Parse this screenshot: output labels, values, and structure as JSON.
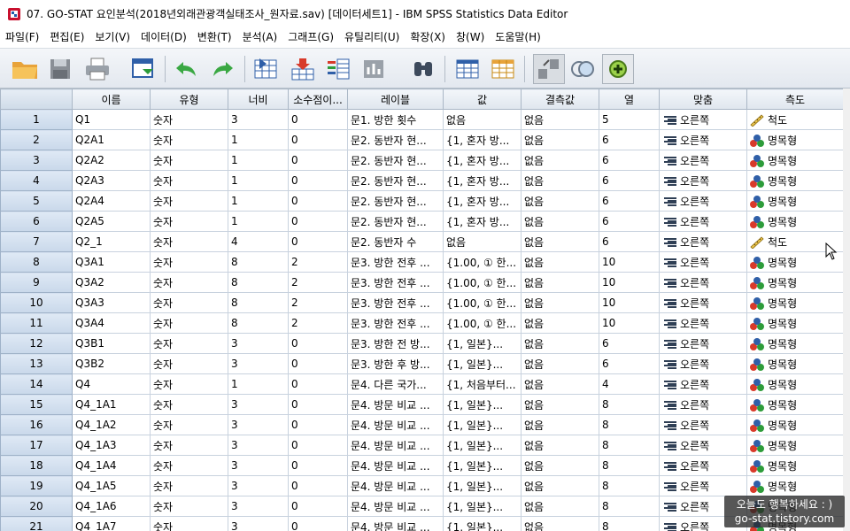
{
  "window": {
    "title": "07. GO-STAT 요인분석(2018년외래관광객실태조사_원자료.sav) [데이터세트1] - IBM SPSS Statistics Data Editor"
  },
  "menu": [
    "파일(F)",
    "편집(E)",
    "보기(V)",
    "데이터(D)",
    "변환(T)",
    "분석(A)",
    "그래프(G)",
    "유틸리티(U)",
    "확장(X)",
    "창(W)",
    "도움말(H)"
  ],
  "toolbar": {
    "icons": [
      "open-folder-icon",
      "save-icon",
      "print-icon",
      "recall-dialog-icon",
      "undo-icon",
      "redo-icon",
      "goto-case-icon",
      "goto-variable-icon",
      "variables-icon",
      "find-icon",
      "insert-cases-icon",
      "insert-variable-icon",
      "split-file-icon",
      "weight-cases-icon",
      "select-cases-icon",
      "value-labels-icon",
      "use-sets-icon"
    ]
  },
  "columns": [
    "이름",
    "유형",
    "너비",
    "소수점이...",
    "레이블",
    "값",
    "결측값",
    "열",
    "맞춤",
    "측도"
  ],
  "colors": {
    "header_bg": "#e4ebf3",
    "rownum_bg": "#d3e0ef",
    "accent": "#2f5fa8"
  },
  "rows": [
    {
      "n": "1",
      "name": "Q1",
      "type": "숫자",
      "width": "3",
      "decimals": "0",
      "label": "문1. 방한 횟수",
      "values": "없음",
      "missing": "없음",
      "columns": "5",
      "align": "오른쪽",
      "measure": "척도",
      "measure_icon": "ruler-icon"
    },
    {
      "n": "2",
      "name": "Q2A1",
      "type": "숫자",
      "width": "1",
      "decimals": "0",
      "label": "문2. 동반자 현...",
      "values": "{1, 혼자 방...",
      "missing": "없음",
      "columns": "6",
      "align": "오른쪽",
      "measure": "명목형",
      "measure_icon": "nominal-icon"
    },
    {
      "n": "3",
      "name": "Q2A2",
      "type": "숫자",
      "width": "1",
      "decimals": "0",
      "label": "문2. 동반자 현...",
      "values": "{1, 혼자 방...",
      "missing": "없음",
      "columns": "6",
      "align": "오른쪽",
      "measure": "명목형",
      "measure_icon": "nominal-icon"
    },
    {
      "n": "4",
      "name": "Q2A3",
      "type": "숫자",
      "width": "1",
      "decimals": "0",
      "label": "문2. 동반자 현...",
      "values": "{1, 혼자 방...",
      "missing": "없음",
      "columns": "6",
      "align": "오른쪽",
      "measure": "명목형",
      "measure_icon": "nominal-icon"
    },
    {
      "n": "5",
      "name": "Q2A4",
      "type": "숫자",
      "width": "1",
      "decimals": "0",
      "label": "문2. 동반자 현...",
      "values": "{1, 혼자 방...",
      "missing": "없음",
      "columns": "6",
      "align": "오른쪽",
      "measure": "명목형",
      "measure_icon": "nominal-icon"
    },
    {
      "n": "6",
      "name": "Q2A5",
      "type": "숫자",
      "width": "1",
      "decimals": "0",
      "label": "문2. 동반자 현...",
      "values": "{1, 혼자 방...",
      "missing": "없음",
      "columns": "6",
      "align": "오른쪽",
      "measure": "명목형",
      "measure_icon": "nominal-icon"
    },
    {
      "n": "7",
      "name": "Q2_1",
      "type": "숫자",
      "width": "4",
      "decimals": "0",
      "label": "문2. 동반자 수",
      "values": "없음",
      "missing": "없음",
      "columns": "6",
      "align": "오른쪽",
      "measure": "척도",
      "measure_icon": "ruler-icon"
    },
    {
      "n": "8",
      "name": "Q3A1",
      "type": "숫자",
      "width": "8",
      "decimals": "2",
      "label": "문3. 방한 전후 ...",
      "values": "{1.00, ① 한...",
      "missing": "없음",
      "columns": "10",
      "align": "오른쪽",
      "measure": "명목형",
      "measure_icon": "nominal-icon"
    },
    {
      "n": "9",
      "name": "Q3A2",
      "type": "숫자",
      "width": "8",
      "decimals": "2",
      "label": "문3. 방한 전후 ...",
      "values": "{1.00, ① 한...",
      "missing": "없음",
      "columns": "10",
      "align": "오른쪽",
      "measure": "명목형",
      "measure_icon": "nominal-icon"
    },
    {
      "n": "10",
      "name": "Q3A3",
      "type": "숫자",
      "width": "8",
      "decimals": "2",
      "label": "문3. 방한 전후 ...",
      "values": "{1.00, ① 한...",
      "missing": "없음",
      "columns": "10",
      "align": "오른쪽",
      "measure": "명목형",
      "measure_icon": "nominal-icon"
    },
    {
      "n": "11",
      "name": "Q3A4",
      "type": "숫자",
      "width": "8",
      "decimals": "2",
      "label": "문3. 방한 전후 ...",
      "values": "{1.00, ① 한...",
      "missing": "없음",
      "columns": "10",
      "align": "오른쪽",
      "measure": "명목형",
      "measure_icon": "nominal-icon"
    },
    {
      "n": "12",
      "name": "Q3B1",
      "type": "숫자",
      "width": "3",
      "decimals": "0",
      "label": "문3. 방한 전 방...",
      "values": "{1, 일본}...",
      "missing": "없음",
      "columns": "6",
      "align": "오른쪽",
      "measure": "명목형",
      "measure_icon": "nominal-icon"
    },
    {
      "n": "13",
      "name": "Q3B2",
      "type": "숫자",
      "width": "3",
      "decimals": "0",
      "label": "문3. 방한 후 방...",
      "values": "{1, 일본}...",
      "missing": "없음",
      "columns": "6",
      "align": "오른쪽",
      "measure": "명목형",
      "measure_icon": "nominal-icon"
    },
    {
      "n": "14",
      "name": "Q4",
      "type": "숫자",
      "width": "1",
      "decimals": "0",
      "label": "문4. 다른 국가...",
      "values": "{1, 처음부터...",
      "missing": "없음",
      "columns": "4",
      "align": "오른쪽",
      "measure": "명목형",
      "measure_icon": "nominal-icon"
    },
    {
      "n": "15",
      "name": "Q4_1A1",
      "type": "숫자",
      "width": "3",
      "decimals": "0",
      "label": "문4. 방문 비교 ...",
      "values": "{1, 일본}...",
      "missing": "없음",
      "columns": "8",
      "align": "오른쪽",
      "measure": "명목형",
      "measure_icon": "nominal-icon"
    },
    {
      "n": "16",
      "name": "Q4_1A2",
      "type": "숫자",
      "width": "3",
      "decimals": "0",
      "label": "문4. 방문 비교 ...",
      "values": "{1, 일본}...",
      "missing": "없음",
      "columns": "8",
      "align": "오른쪽",
      "measure": "명목형",
      "measure_icon": "nominal-icon"
    },
    {
      "n": "17",
      "name": "Q4_1A3",
      "type": "숫자",
      "width": "3",
      "decimals": "0",
      "label": "문4. 방문 비교 ...",
      "values": "{1, 일본}...",
      "missing": "없음",
      "columns": "8",
      "align": "오른쪽",
      "measure": "명목형",
      "measure_icon": "nominal-icon"
    },
    {
      "n": "18",
      "name": "Q4_1A4",
      "type": "숫자",
      "width": "3",
      "decimals": "0",
      "label": "문4. 방문 비교 ...",
      "values": "{1, 일본}...",
      "missing": "없음",
      "columns": "8",
      "align": "오른쪽",
      "measure": "명목형",
      "measure_icon": "nominal-icon"
    },
    {
      "n": "19",
      "name": "Q4_1A5",
      "type": "숫자",
      "width": "3",
      "decimals": "0",
      "label": "문4. 방문 비교 ...",
      "values": "{1, 일본}...",
      "missing": "없음",
      "columns": "8",
      "align": "오른쪽",
      "measure": "명목형",
      "measure_icon": "nominal-icon"
    },
    {
      "n": "20",
      "name": "Q4_1A6",
      "type": "숫자",
      "width": "3",
      "decimals": "0",
      "label": "문4. 방문 비교 ...",
      "values": "{1, 일본}...",
      "missing": "없음",
      "columns": "8",
      "align": "오른쪽",
      "measure": "명목형",
      "measure_icon": "nominal-icon"
    },
    {
      "n": "21",
      "name": "Q4_1A7",
      "type": "숫자",
      "width": "3",
      "decimals": "0",
      "label": "문4. 방문 비교 ...",
      "values": "{1, 일본}...",
      "missing": "없음",
      "columns": "8",
      "align": "오른쪽",
      "measure": "명목형",
      "measure_icon": "nominal-icon"
    }
  ],
  "watermark": {
    "line1": "오늘도 행복하세요 : )",
    "line2": "go-stat.tistory.com"
  }
}
